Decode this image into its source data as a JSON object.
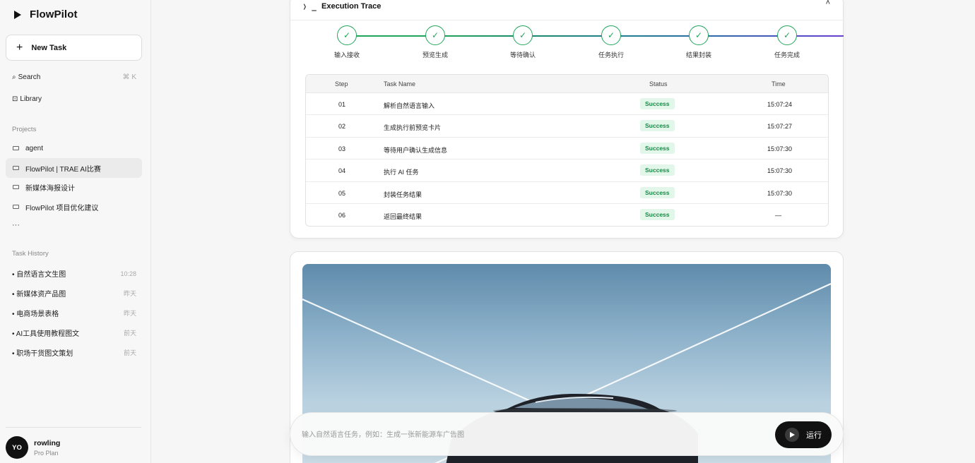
{
  "app": {
    "name": "FlowPilot"
  },
  "sidebar": {
    "new_task": "New Task",
    "search": {
      "label": "Search",
      "shortcut": "⌘ K"
    },
    "library": "Library",
    "projects_label": "Projects",
    "projects": [
      "agent",
      "FlowPilot | TRAE AI比赛",
      "新媒体海报设计",
      "FlowPilot 项目优化建议"
    ],
    "active_project_index": 1,
    "more": "···",
    "history_label": "Task History",
    "history": [
      {
        "label": "• 自然语言文生图",
        "time": "10:28"
      },
      {
        "label": "• 新媒体资产品图",
        "time": "昨天"
      },
      {
        "label": "• 电商场景表格",
        "time": "昨天"
      },
      {
        "label": "• AI工具使用教程图文",
        "time": "前天"
      },
      {
        "label": "• 职场干货图文策划",
        "time": "前天"
      }
    ],
    "user": {
      "initials": "YO",
      "name": "rowling",
      "plan": "Pro Plan"
    }
  },
  "trace": {
    "prompt_symbol": "❭ _",
    "title": "Execution Trace",
    "collapse_glyph": "˄",
    "steps": [
      "输入接收",
      "预览生成",
      "等待确认",
      "任务执行",
      "结果封装",
      "任务完成"
    ],
    "columns": {
      "step": "Step",
      "name": "Task Name",
      "status": "Status",
      "time": "Time"
    },
    "rows": [
      {
        "step": "01",
        "name": "解析自然语言输入",
        "status": "Success",
        "time": "15:07:24"
      },
      {
        "step": "02",
        "name": "生成执行前预览卡片",
        "status": "Success",
        "time": "15:07:27"
      },
      {
        "step": "03",
        "name": "等待用户确认生成信息",
        "status": "Success",
        "time": "15:07:30"
      },
      {
        "step": "04",
        "name": "执行 AI 任务",
        "status": "Success",
        "time": "15:07:30"
      },
      {
        "step": "05",
        "name": "封装任务结果",
        "status": "Success",
        "time": "15:07:30"
      },
      {
        "step": "06",
        "name": "返回最终结果",
        "status": "Success",
        "time": "—"
      }
    ]
  },
  "prompt": {
    "placeholder": "输入自然语言任务，例如：生成一张新能源车广告图",
    "run_label": "运行"
  }
}
